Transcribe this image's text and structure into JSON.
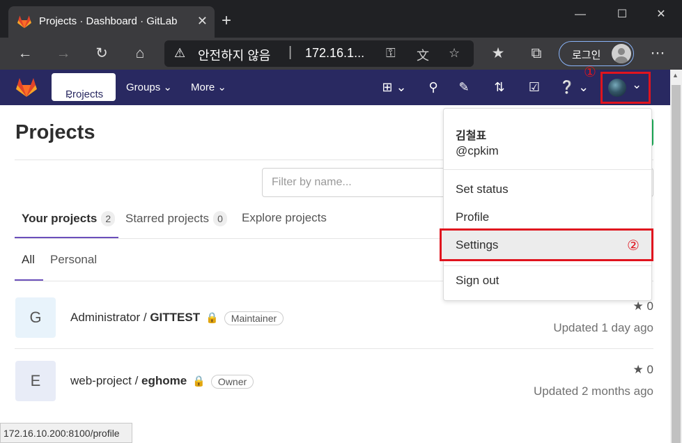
{
  "browser": {
    "tab_title": "Projects · Dashboard · GitLab",
    "tab_close": "✕",
    "new_tab": "+",
    "security_label": "안전하지 않음",
    "url_host": "172.16.1...",
    "login_label": "로그인",
    "status_url": "172.16.10.200:8100/profile"
  },
  "header": {
    "projects": "Projects",
    "groups": "Groups",
    "more": "More",
    "marker_1": "①"
  },
  "page": {
    "title": "Projects",
    "filter_placeholder": "Filter by name..."
  },
  "tabs": [
    {
      "label": "Your projects",
      "count": "2"
    },
    {
      "label": "Starred projects",
      "count": "0"
    },
    {
      "label": "Explore projects"
    }
  ],
  "subtabs": [
    "All",
    "Personal"
  ],
  "projects": [
    {
      "avatar": "G",
      "namespace": "Administrator / ",
      "name": "GITTEST",
      "role": "Maintainer",
      "stars": "0",
      "updated": "Updated 1 day ago"
    },
    {
      "avatar": "E",
      "namespace": "web-project / ",
      "name": "eghome",
      "role": "Owner",
      "stars": "0",
      "updated": "Updated 2 months ago"
    }
  ],
  "dropdown": {
    "name": "김철표",
    "handle": "@cpkim",
    "items": [
      "Set status",
      "Profile",
      "Settings",
      "Sign out"
    ],
    "marker_2": "②"
  },
  "colors": {
    "header_bg": "#292961",
    "highlight": "#e0141e",
    "accent": "#6b4fbb"
  }
}
